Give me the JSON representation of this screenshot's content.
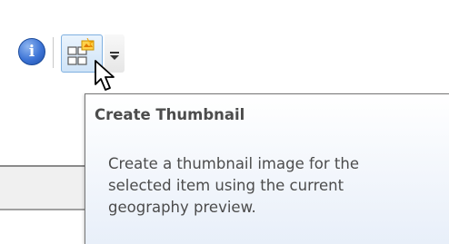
{
  "toolbar": {
    "info_button": {
      "icon": "info-icon",
      "glyph": "i"
    },
    "create_thumbnail_button": {
      "icon": "create-thumbnail-icon"
    },
    "overflow_button": {
      "icon": "dropdown-arrow-icon"
    }
  },
  "tooltip": {
    "title": "Create Thumbnail",
    "description": "Create a thumbnail image for the\nselected item using the current\ngeography preview."
  },
  "cursor": {
    "icon": "mouse-pointer-icon"
  },
  "colors": {
    "tooltip_border": "#767676",
    "tooltip_text": "#4c4c4c",
    "info_blue": "#3d74d6",
    "button_hover_border": "#7fb0e0"
  }
}
